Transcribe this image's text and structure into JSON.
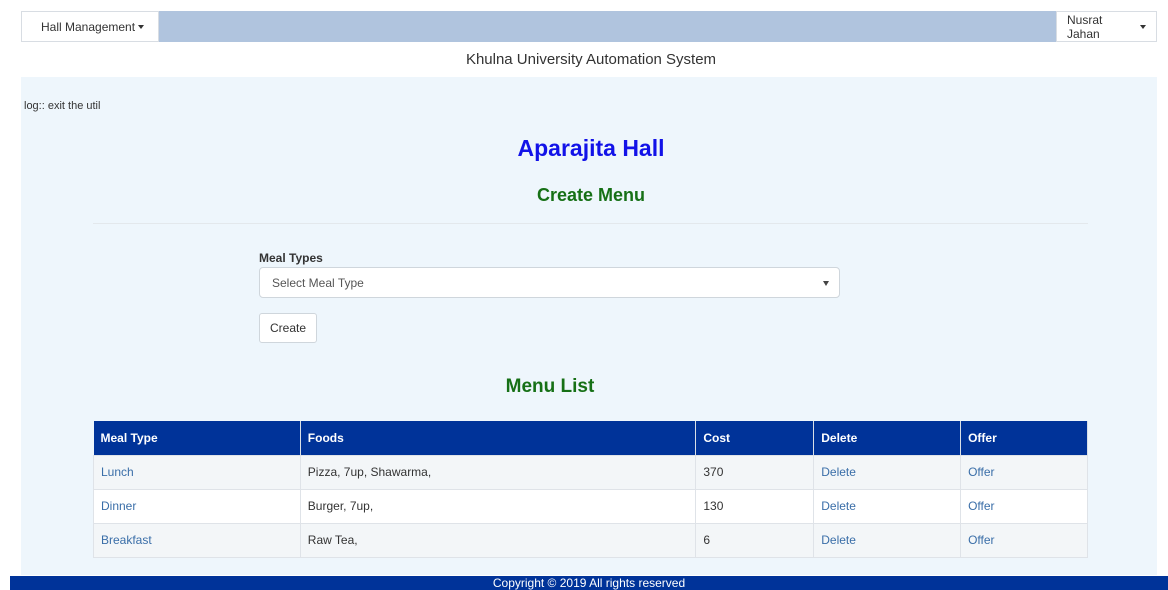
{
  "nav": {
    "left_menu": "Hall Management",
    "right_menu": "Nusrat Jahan"
  },
  "site_title": "Khulna University Automation System",
  "log_text": "log:: exit the util",
  "hall_name": "Aparajita Hall",
  "create_heading": "Create Menu",
  "form": {
    "meal_types_label": "Meal Types",
    "select_value": "Select Meal Type",
    "create_button": "Create"
  },
  "list_heading": "Menu List",
  "table": {
    "headers": [
      "Meal Type",
      "Foods",
      "Cost",
      "Delete",
      "Offer"
    ],
    "rows": [
      {
        "meal_type": "Lunch",
        "foods": "Pizza, 7up, Shawarma,",
        "cost": "370",
        "delete": "Delete",
        "offer": "Offer"
      },
      {
        "meal_type": "Dinner",
        "foods": "Burger, 7up,",
        "cost": "130",
        "delete": "Delete",
        "offer": "Offer"
      },
      {
        "meal_type": "Breakfast",
        "foods": "Raw Tea,",
        "cost": "6",
        "delete": "Delete",
        "offer": "Offer"
      }
    ]
  },
  "footer": "Copyright © 2019 All rights reserved",
  "colors": {
    "nav_bar": "#b0c4de",
    "content_bg": "#eef6fc",
    "hall_title": "#1212e8",
    "section_heading": "#167016",
    "table_header": "#003399",
    "link": "#3a6ea8"
  }
}
